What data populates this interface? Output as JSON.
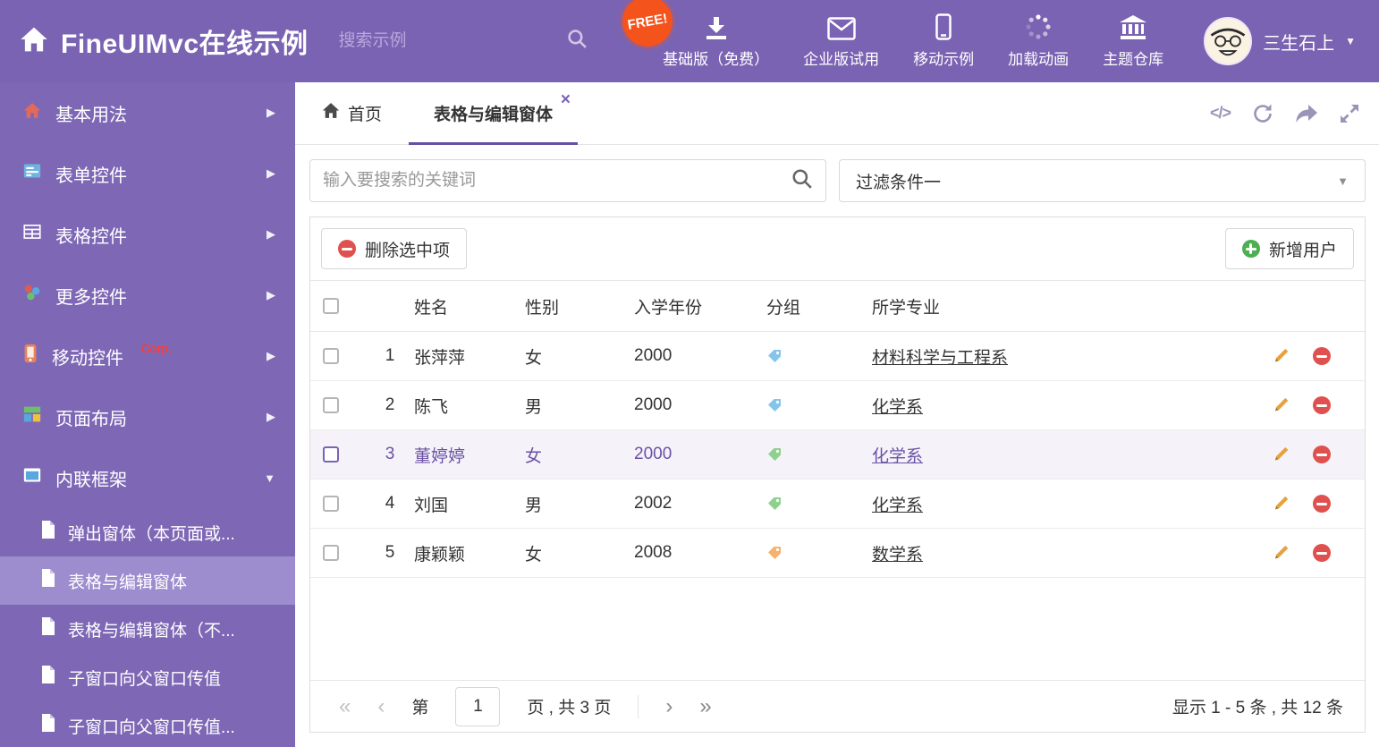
{
  "header": {
    "title": "FineUIMvc在线示例",
    "search_placeholder": "搜索示例",
    "free_badge": "FREE!",
    "nav_items": [
      {
        "label": "基础版（免费）"
      },
      {
        "label": "企业版试用"
      },
      {
        "label": "移动示例"
      },
      {
        "label": "加载动画"
      },
      {
        "label": "主题仓库"
      }
    ],
    "username": "三生石上"
  },
  "sidebar": {
    "items": [
      {
        "label": "基本用法"
      },
      {
        "label": "表单控件"
      },
      {
        "label": "表格控件"
      },
      {
        "label": "更多控件"
      },
      {
        "label": "移动控件",
        "badge": "Corp."
      },
      {
        "label": "页面布局"
      },
      {
        "label": "内联框架"
      }
    ],
    "subitems": [
      {
        "label": "弹出窗体（本页面或..."
      },
      {
        "label": "表格与编辑窗体"
      },
      {
        "label": "表格与编辑窗体（不..."
      },
      {
        "label": "子窗口向父窗口传值"
      },
      {
        "label": "子窗口向父窗口传值..."
      }
    ]
  },
  "tabbar": {
    "tabs": [
      {
        "label": "首页"
      },
      {
        "label": "表格与编辑窗体"
      }
    ]
  },
  "filters": {
    "search_placeholder": "输入要搜索的关键词",
    "dropdown_value": "过滤条件一"
  },
  "toolbar": {
    "delete_label": "删除选中项",
    "add_label": "新增用户"
  },
  "table": {
    "columns": {
      "name": "姓名",
      "gender": "性别",
      "year": "入学年份",
      "group": "分组",
      "major": "所学专业"
    },
    "rows": [
      {
        "num": "1",
        "name": "张萍萍",
        "gender": "女",
        "year": "2000",
        "tag_color": "#85c5ec",
        "major": "材料科学与工程系"
      },
      {
        "num": "2",
        "name": "陈飞",
        "gender": "男",
        "year": "2000",
        "tag_color": "#85c5ec",
        "major": "化学系"
      },
      {
        "num": "3",
        "name": "董婷婷",
        "gender": "女",
        "year": "2000",
        "tag_color": "#8ed08e",
        "major": "化学系"
      },
      {
        "num": "4",
        "name": "刘国",
        "gender": "男",
        "year": "2002",
        "tag_color": "#8ed08e",
        "major": "化学系"
      },
      {
        "num": "5",
        "name": "康颖颖",
        "gender": "女",
        "year": "2008",
        "tag_color": "#f4b26e",
        "major": "数学系"
      }
    ]
  },
  "pagination": {
    "label_prefix": "第",
    "page_value": "1",
    "label_suffix": "页 , 共 3 页",
    "summary": "显示 1 - 5 条 , 共 12 条"
  },
  "icons": {
    "chevron_right": "▶",
    "chevron_down": "▼",
    "caret_down": "▼",
    "close": "×",
    "code": "</>",
    "first": "«",
    "prev": "‹",
    "next": "›",
    "last": "»"
  },
  "colors": {
    "header_bg": "#7a63b2",
    "sidebar_bg": "#7e68b6",
    "sidebar_active_bg": "#9d8cce",
    "accent": "#6a4fa3",
    "free_badge_bg": "#f4531c",
    "delete_red": "#e0504e",
    "add_green": "#4caf50",
    "pencil_orange": "#e7a23c"
  }
}
